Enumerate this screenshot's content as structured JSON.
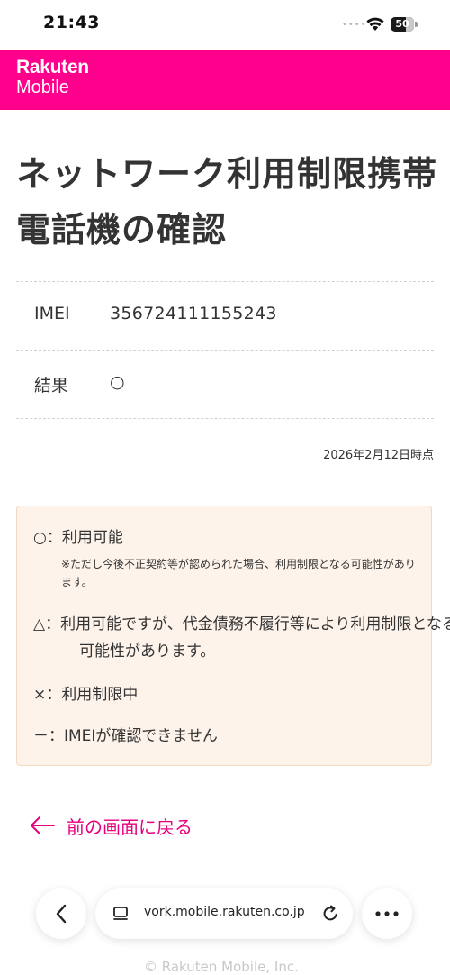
{
  "status_bar": {
    "time": "21:43",
    "signal_dots": "••••",
    "battery_percent": 50,
    "battery_label": "50"
  },
  "header": {
    "logo_line1": "Rakuten",
    "logo_line2": "Mobile",
    "brand_color": "#ff008c"
  },
  "page_title": "ネットワーク利用制限携帯電話機の確認",
  "result": {
    "rows": [
      {
        "label": "IMEI",
        "value": "356724111155243"
      },
      {
        "label": "結果",
        "value": "○"
      }
    ],
    "as_of": "2026年2月12日時点"
  },
  "legend": {
    "available": "○：利用可能",
    "available_note": "※ただし今後不正契約等が認められた場合、利用制限となる可能性があります。",
    "triangle": "△：利用可能ですが、代金債務不履行等により利用制限となる可能性があります。",
    "restricted": "×：利用制限中",
    "unconfirmed": "－：IMEIが確認できません"
  },
  "back_link": "前の画面に戻る",
  "footer": "© Rakuten Mobile, Inc.",
  "browser": {
    "url": "vork.mobile.rakuten.co.jp",
    "back_icon": "chevron-left-icon",
    "tabs_icon": "tabs-icon",
    "reload_icon": "reload-icon",
    "menu_icon": "more-icon"
  }
}
